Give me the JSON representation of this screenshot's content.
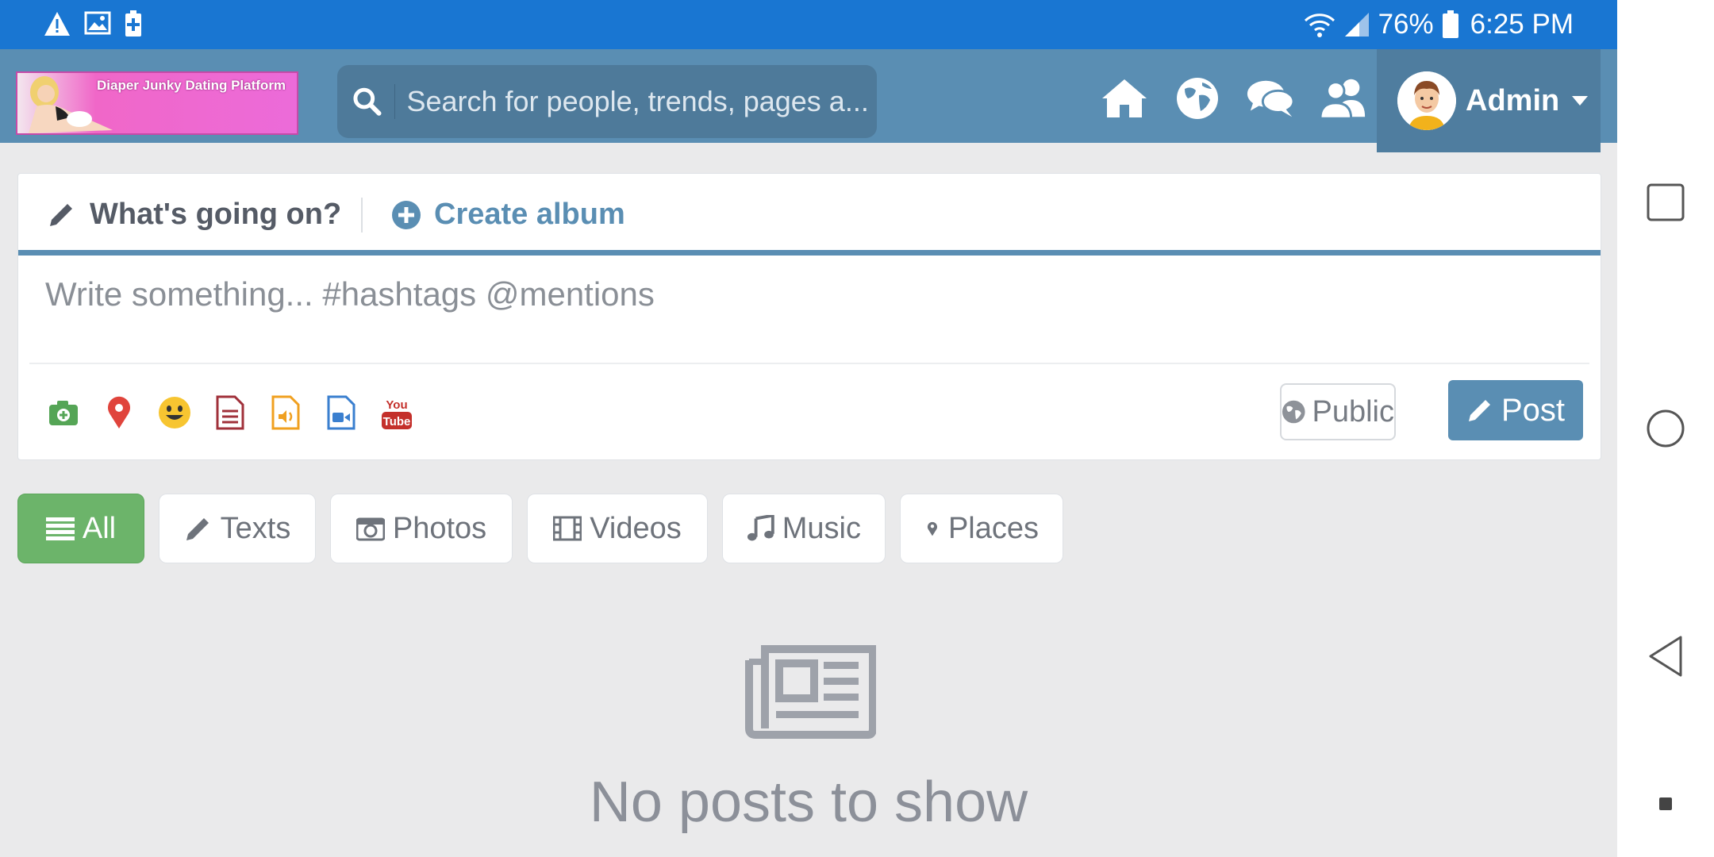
{
  "status_bar": {
    "battery": "76%",
    "time": "6:25 PM"
  },
  "header": {
    "logo_text": "Diaper Junky Dating Platform",
    "search_placeholder": "Search for people, trends, pages a...",
    "user_name": "Admin"
  },
  "composer": {
    "tab_write": "What's going on?",
    "tab_album": "Create album",
    "placeholder": "Write something... #hashtags @mentions",
    "privacy_label": "Public",
    "post_label": "Post"
  },
  "filters": [
    {
      "label": "All",
      "icon": "list-icon",
      "active": true
    },
    {
      "label": "Texts",
      "icon": "pencil-icon"
    },
    {
      "label": "Photos",
      "icon": "camera-icon"
    },
    {
      "label": "Videos",
      "icon": "film-icon"
    },
    {
      "label": "Music",
      "icon": "music-note-icon"
    },
    {
      "label": "Places",
      "icon": "map-pin-icon"
    }
  ],
  "empty_state": {
    "message": "No posts to show",
    "icon": "newspaper-icon"
  },
  "colors": {
    "status_bar": "#1976d2",
    "header": "#5a8eb3",
    "active_filter": "#6cb46a",
    "post_button": "#5a8eb3"
  }
}
